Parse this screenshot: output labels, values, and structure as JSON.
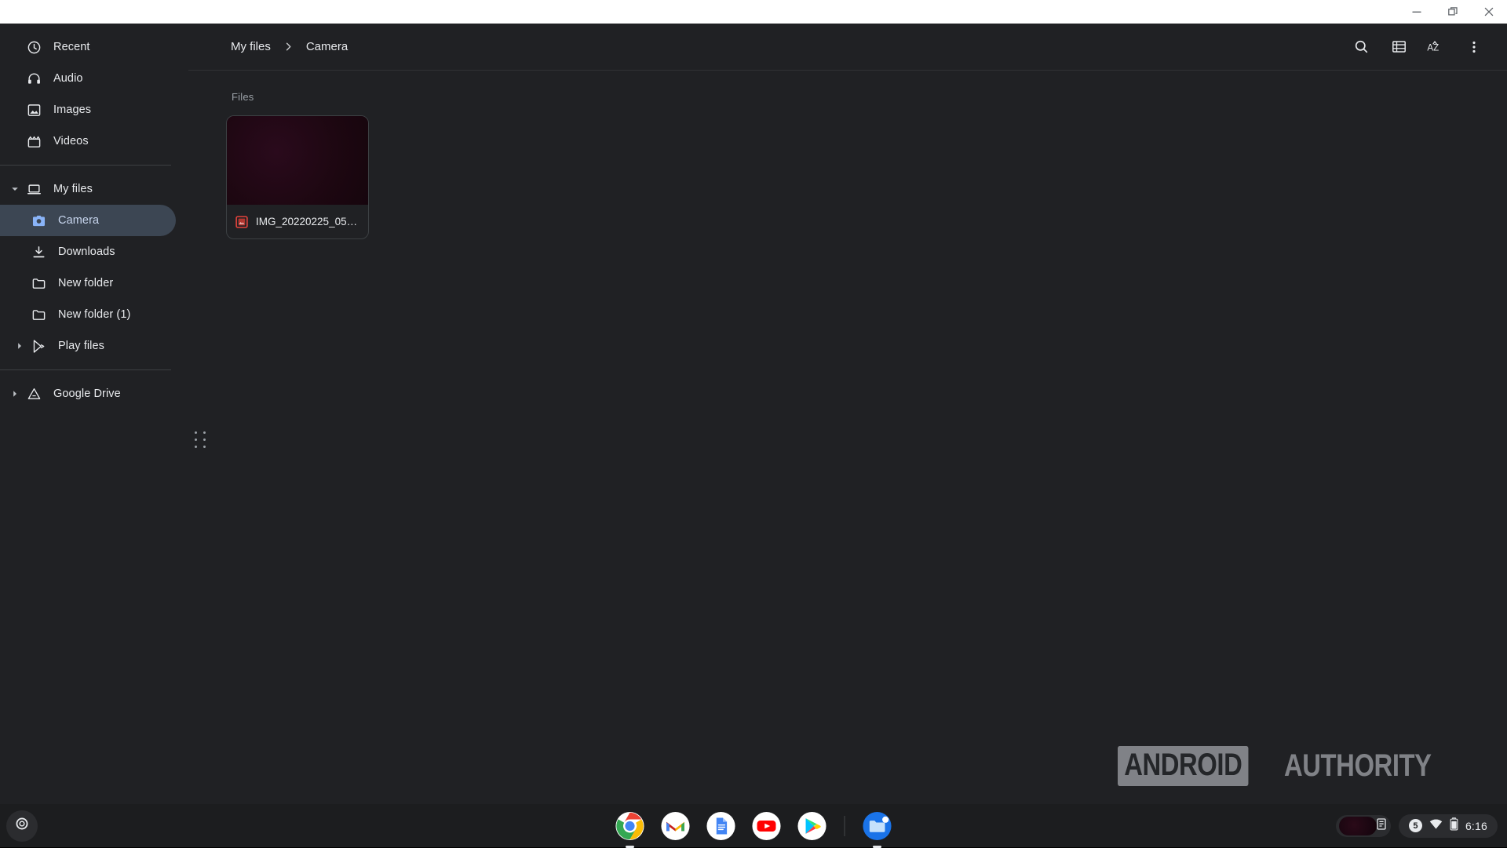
{
  "window": {
    "controls": [
      {
        "name": "minimize",
        "label": "Minimize"
      },
      {
        "name": "restore",
        "label": "Restore"
      },
      {
        "name": "close",
        "label": "Close"
      }
    ]
  },
  "sidebar": {
    "groups": [
      {
        "items": [
          {
            "label": "Recent",
            "icon": "clock-icon",
            "indent": 0,
            "twisty": "none",
            "selected": false
          },
          {
            "label": "Audio",
            "icon": "headphones-icon",
            "indent": 0,
            "twisty": "none",
            "selected": false
          },
          {
            "label": "Images",
            "icon": "image-icon",
            "indent": 0,
            "twisty": "none",
            "selected": false
          },
          {
            "label": "Videos",
            "icon": "video-icon",
            "indent": 0,
            "twisty": "none",
            "selected": false
          }
        ]
      },
      {
        "items": [
          {
            "label": "My files",
            "icon": "laptop-icon",
            "indent": 0,
            "twisty": "expanded",
            "selected": false
          },
          {
            "label": "Camera",
            "icon": "camera-icon",
            "indent": 1,
            "twisty": "none",
            "selected": true
          },
          {
            "label": "Downloads",
            "icon": "download-icon",
            "indent": 1,
            "twisty": "none",
            "selected": false
          },
          {
            "label": "New folder",
            "icon": "folder-icon",
            "indent": 1,
            "twisty": "none",
            "selected": false
          },
          {
            "label": "New folder (1)",
            "icon": "folder-icon",
            "indent": 1,
            "twisty": "none",
            "selected": false
          },
          {
            "label": "Play files",
            "icon": "play-store-icon",
            "indent": 1,
            "twisty": "collapsed",
            "selected": false
          }
        ]
      },
      {
        "items": [
          {
            "label": "Google Drive",
            "icon": "google-drive-icon",
            "indent": 0,
            "twisty": "collapsed",
            "selected": false
          }
        ]
      }
    ],
    "resize_handle": "sidebar-resize-handle"
  },
  "toolbar": {
    "breadcrumb": {
      "root": "My files",
      "current": "Camera",
      "separator": "›"
    },
    "actions": [
      {
        "name": "search-button",
        "icon": "search-icon",
        "label": "Search"
      },
      {
        "name": "list-view-button",
        "icon": "list-view-icon",
        "label": "List view"
      },
      {
        "name": "sort-button",
        "icon": "sort-az-icon",
        "label": "AZ"
      },
      {
        "name": "more-button",
        "icon": "more-vert-icon",
        "label": "More options"
      }
    ]
  },
  "main": {
    "section_title": "Files",
    "files": [
      {
        "name": "IMG_20220225_055...",
        "badge": "image-file-icon",
        "thumb_color": "#1d0711"
      }
    ]
  },
  "watermark": {
    "part1": "ANDROID",
    "part2": "AUTHORITY"
  },
  "shelf": {
    "launcher": "launcher-button",
    "apps": [
      {
        "name": "chrome",
        "label": "Chrome",
        "active": true
      },
      {
        "name": "gmail",
        "label": "Gmail",
        "active": false
      },
      {
        "name": "docs",
        "label": "Docs",
        "active": false
      },
      {
        "name": "youtube",
        "label": "YouTube",
        "active": false
      },
      {
        "name": "play-store",
        "label": "Play Store",
        "active": false
      },
      {
        "name": "files",
        "label": "Files",
        "active": true
      }
    ],
    "tray": {
      "notification_count": "5",
      "icons": [
        "wifi-icon",
        "battery-icon"
      ],
      "clock": "6:16"
    }
  },
  "colors": {
    "window_bg": "#202124",
    "selected_nav": "#3c4653",
    "accent": "#8ab4f8",
    "text": "#e8eaed",
    "muted": "#9aa0a6"
  }
}
